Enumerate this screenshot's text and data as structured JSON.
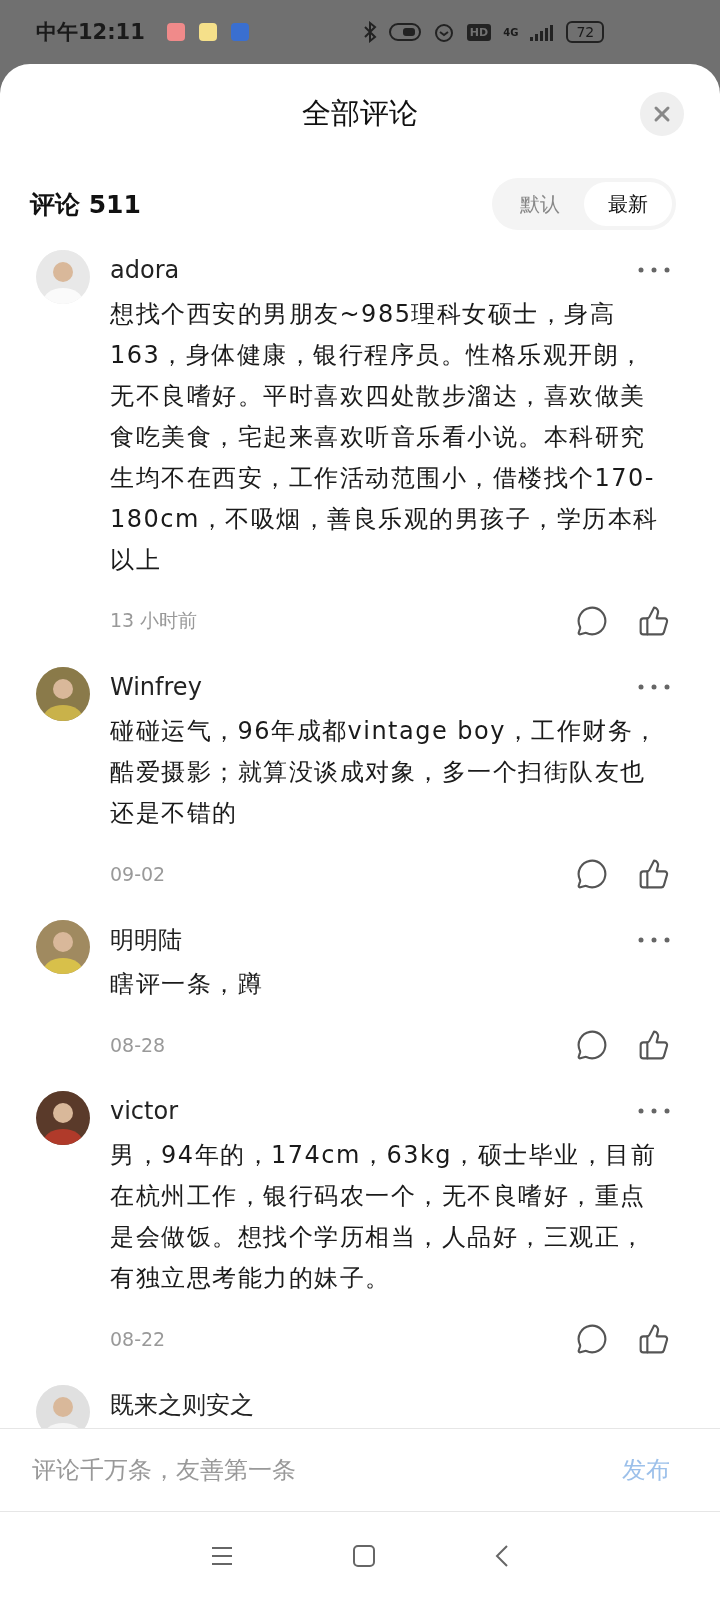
{
  "status_bar": {
    "time": "中午12:11",
    "hd": "HD",
    "network": "4G",
    "battery": "72"
  },
  "sheet": {
    "title": "全部评论"
  },
  "comment_header": {
    "label": "评论 511",
    "sort_tabs": [
      {
        "label": "默认",
        "selected": false
      },
      {
        "label": "最新",
        "selected": true
      }
    ]
  },
  "comments": [
    {
      "user": "adora",
      "text": "想找个西安的男朋友~985理科女硕士，身高163，身体健康，银行程序员。性格乐观开朗，无不良嗜好。平时喜欢四处散步溜达，喜欢做美食吃美食，宅起来喜欢听音乐看小说。本科研究生均不在西安，工作活动范围小，借楼找个170-180cm，不吸烟，善良乐观的男孩子，学历本科以上",
      "time": "13 小时前"
    },
    {
      "user": "Winfrey",
      "text": "碰碰运气，96年成都vintage boy，工作财务，酷爱摄影；就算没谈成对象，多一个扫街队友也还是不错的",
      "time": "09-02"
    },
    {
      "user": "明明陆",
      "text": "瞎评一条，蹲",
      "time": "08-28"
    },
    {
      "user": "victor",
      "text": "男，94年的，174cm，63kg，硕士毕业，目前在杭州工作，银行码农一个，无不良嗜好，重点是会做饭。想找个学历相当，人品好，三观正，有独立思考能力的妹子。",
      "time": "08-22"
    },
    {
      "user": "既来之则安之"
    }
  ],
  "composer": {
    "placeholder": "评论千万条，友善第一条",
    "submit": "发布"
  }
}
